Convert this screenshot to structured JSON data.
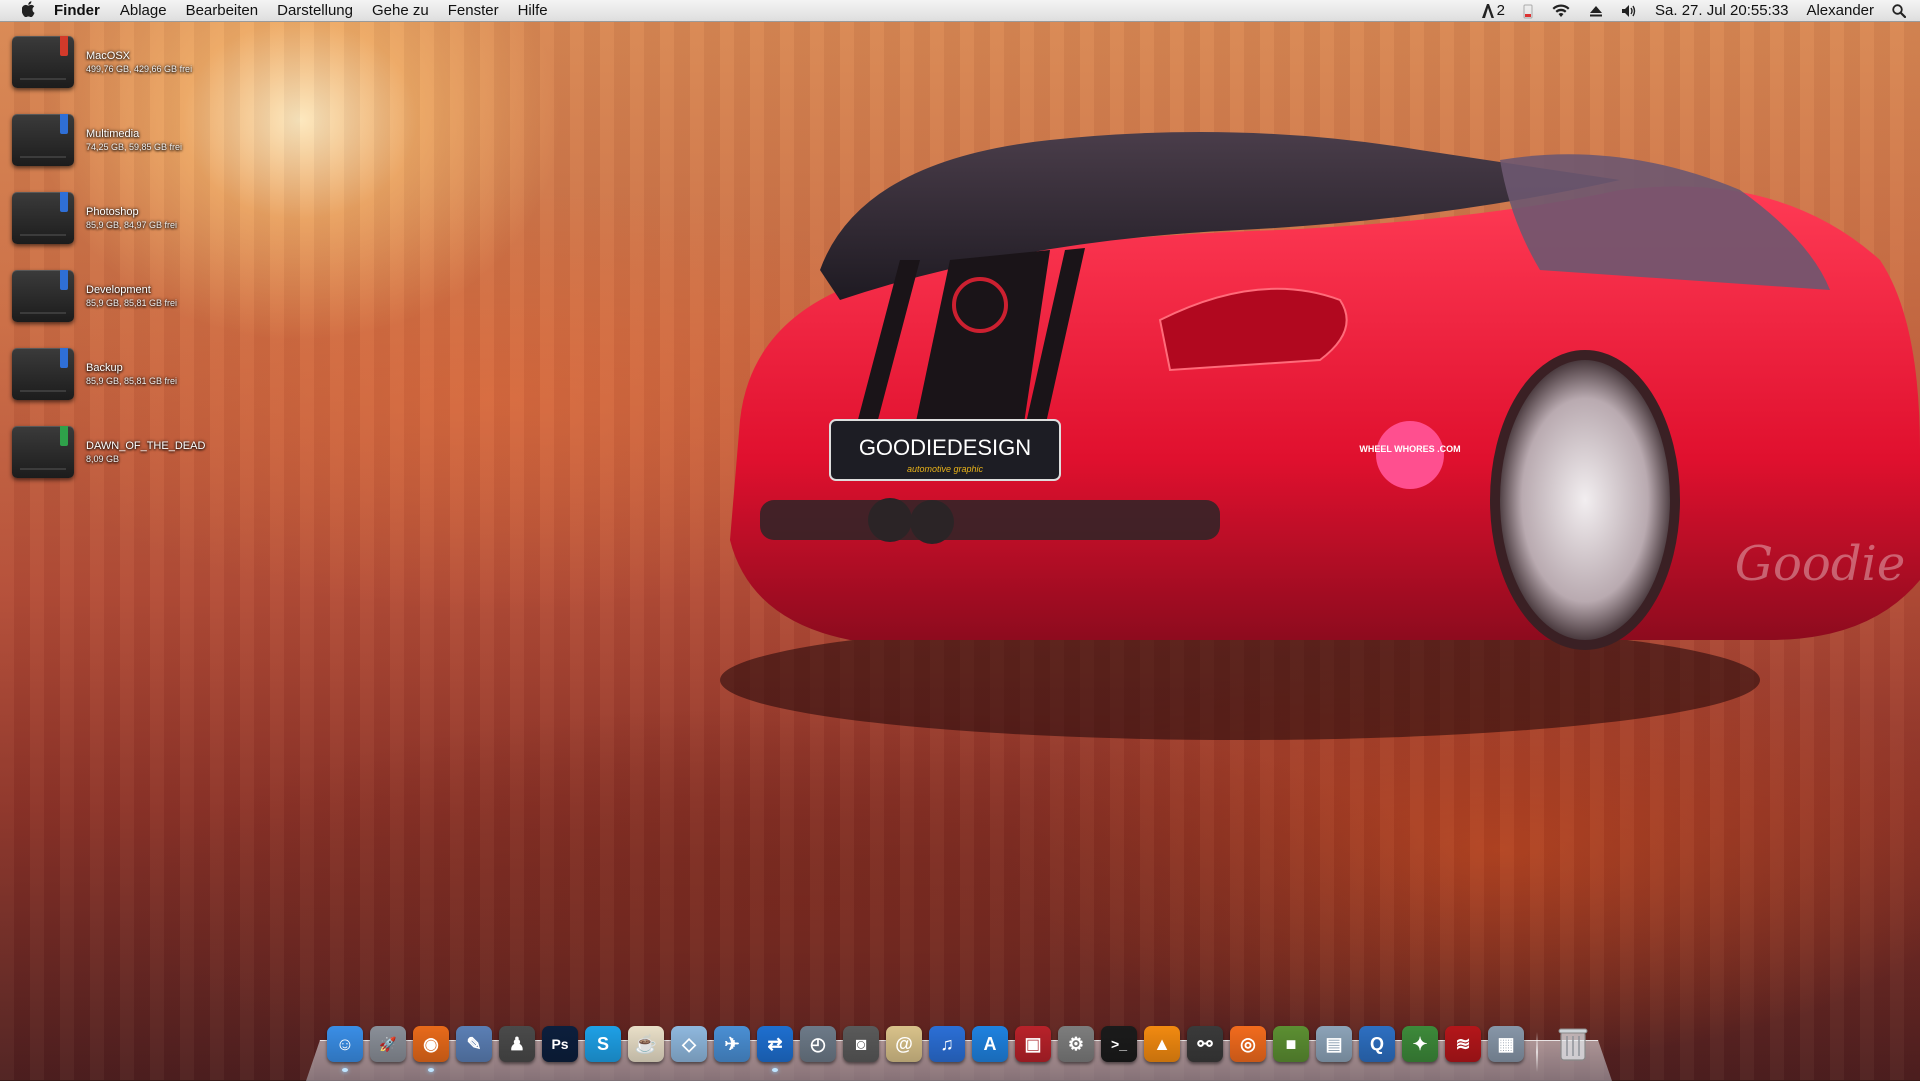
{
  "menubar": {
    "app_name": "Finder",
    "items": [
      "Ablage",
      "Bearbeiten",
      "Darstellung",
      "Gehe zu",
      "Fenster",
      "Hilfe"
    ],
    "status": {
      "notification_count": "2",
      "datetime": "Sa. 27. Jul  20:55:33",
      "user": "Alexander"
    }
  },
  "desktop": {
    "drives": [
      {
        "name": "MacOSX",
        "info": "499,76 GB, 429,66 GB frei",
        "tag_color": "#d23a2a"
      },
      {
        "name": "Multimedia",
        "info": "74,25 GB, 59,85 GB frei",
        "tag_color": "#2f6fd6"
      },
      {
        "name": "Photoshop",
        "info": "85,9 GB, 84,97 GB frei",
        "tag_color": "#2f6fd6"
      },
      {
        "name": "Development",
        "info": "85,9 GB, 85,81 GB frei",
        "tag_color": "#2f6fd6"
      },
      {
        "name": "Backup",
        "info": "85,9 GB, 85,81 GB frei",
        "tag_color": "#2f6fd6"
      },
      {
        "name": "DAWN_OF_THE_DEAD",
        "info": "8,09 GB",
        "tag_color": "#2fa14a"
      }
    ]
  },
  "wallpaper": {
    "plate_text": "GOODIEDESIGN",
    "plate_subtext": "automotive graphic",
    "sticker_text": "WHEEL WHORES .COM",
    "signature": "Goodie"
  },
  "dock": {
    "apps": [
      {
        "icon": "finder-icon",
        "color": "#3a8ee6",
        "glyph": "☺",
        "running": true
      },
      {
        "icon": "launchpad-icon",
        "color": "#8a8f98",
        "glyph": "🚀",
        "running": false
      },
      {
        "icon": "firefox-icon",
        "color": "#e86a1a",
        "glyph": "◉",
        "running": true
      },
      {
        "icon": "preview-icon",
        "color": "#5b7fb5",
        "glyph": "✎",
        "running": false
      },
      {
        "icon": "hacker-icon",
        "color": "#4a4a4a",
        "glyph": "♟",
        "running": false
      },
      {
        "icon": "photoshop-icon",
        "color": "#0c1f3d",
        "glyph": "Ps",
        "running": false
      },
      {
        "icon": "skype-icon",
        "color": "#1ea0e6",
        "glyph": "S",
        "running": false
      },
      {
        "icon": "coffee-icon",
        "color": "#e9dfc8",
        "glyph": "☕",
        "running": false
      },
      {
        "icon": "virtualbox-icon",
        "color": "#8fb8de",
        "glyph": "◇",
        "running": false
      },
      {
        "icon": "mail-icon",
        "color": "#4a8fd4",
        "glyph": "✈",
        "running": false
      },
      {
        "icon": "teamviewer-icon",
        "color": "#1e6fd0",
        "glyph": "⇄",
        "running": true
      },
      {
        "icon": "time-machine-icon",
        "color": "#6d7a88",
        "glyph": "◴",
        "running": false
      },
      {
        "icon": "facetime-icon",
        "color": "#5a5a5a",
        "glyph": "◙",
        "running": false
      },
      {
        "icon": "contacts-icon",
        "color": "#d9c28a",
        "glyph": "@",
        "running": false
      },
      {
        "icon": "itunes-icon",
        "color": "#2b6fd6",
        "glyph": "♫",
        "running": false
      },
      {
        "icon": "app-store-icon",
        "color": "#1f82e0",
        "glyph": "A",
        "running": false
      },
      {
        "icon": "photo-booth-icon",
        "color": "#b8222a",
        "glyph": "▣",
        "running": false
      },
      {
        "icon": "system-preferences-icon",
        "color": "#7d7d7d",
        "glyph": "⚙",
        "running": false
      },
      {
        "icon": "terminal-icon",
        "color": "#1b1b1b",
        "glyph": ">_",
        "running": false
      },
      {
        "icon": "vlc-icon",
        "color": "#f28a10",
        "glyph": "▲",
        "running": false
      },
      {
        "icon": "steam-icon",
        "color": "#3a3a3a",
        "glyph": "⚯",
        "running": false
      },
      {
        "icon": "origin-icon",
        "color": "#f26b1d",
        "glyph": "◎",
        "running": false
      },
      {
        "icon": "minecraft-icon",
        "color": "#5c8f32",
        "glyph": "■",
        "running": false
      },
      {
        "icon": "preview-photos-icon",
        "color": "#8ca3b8",
        "glyph": "▤",
        "running": false
      },
      {
        "icon": "quicktime-icon",
        "color": "#2d6fc1",
        "glyph": "Q",
        "running": false
      },
      {
        "icon": "globe-icon",
        "color": "#3d8a3a",
        "glyph": "✦",
        "running": false
      },
      {
        "icon": "filezilla-icon",
        "color": "#b4161a",
        "glyph": "≋",
        "running": false
      },
      {
        "icon": "image-capture-icon",
        "color": "#8796a8",
        "glyph": "▦",
        "running": false
      }
    ],
    "trash": {
      "icon": "trash-icon"
    }
  }
}
